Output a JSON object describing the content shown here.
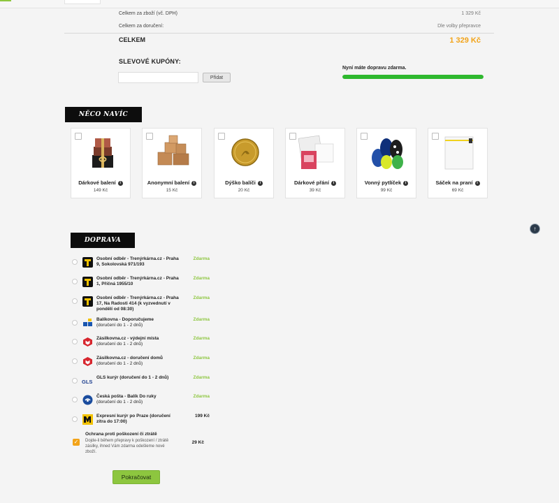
{
  "summary": {
    "items_label": "Celkem za zboží (vč. DPH)",
    "items_value": "1 329 Kč",
    "delivery_label": "Celkem za doručení:",
    "delivery_value": "Dle volby přepravce",
    "total_label": "CELKEM",
    "total_value": "1 329 Kč"
  },
  "coupons": {
    "title": "SLEVOVÉ KUPÓNY:",
    "input_value": "",
    "button_label": "Přidat"
  },
  "free_shipping": {
    "message": "Nyní máte dopravu zdarma.",
    "progress_percent": 100,
    "bar_color": "#2eb82e"
  },
  "extras": {
    "banner": "NĚCO NAVÍC",
    "items": [
      {
        "name": "Dárkové balení",
        "price": "149 Kč",
        "checked": false,
        "icon": "gift-box-icon"
      },
      {
        "name": "Anonymní balení",
        "price": "15 Kč",
        "checked": false,
        "icon": "cardboard-boxes-icon"
      },
      {
        "name": "Dýško balíči",
        "price": "20 Kč",
        "checked": false,
        "icon": "gold-coin-icon"
      },
      {
        "name": "Dárkové přání",
        "price": "39 Kč",
        "checked": false,
        "icon": "greeting-card-icon"
      },
      {
        "name": "Vonný pytlíček",
        "price": "99 Kč",
        "checked": false,
        "icon": "scent-sachet-icon"
      },
      {
        "name": "Sáček na praní",
        "price": "69 Kč",
        "checked": false,
        "icon": "laundry-bag-icon"
      }
    ]
  },
  "shipping": {
    "banner": "DOPRAVA",
    "options": [
      {
        "title": "Osobní odběr - Trenýrkárna.cz - Praha 9, Sokolovská 971/193",
        "sub": "",
        "price": "Zdarma",
        "logo": "trenyrkarna-logo-icon"
      },
      {
        "title": "Osobní odběr - Trenýrkárna.cz - Praha 1, Příčná 1955/10",
        "sub": "",
        "price": "Zdarma",
        "logo": "trenyrkarna-logo-icon"
      },
      {
        "title": "Osobní odběr - Trenýrkárna.cz - Praha 17, Na Radosti 414 (k vyzvednutí v pondělí od 08:30)",
        "sub": "",
        "price": "Zdarma",
        "logo": "trenyrkarna-logo-icon"
      },
      {
        "title": "Balíkovna - Doporučujeme",
        "sub": "(doručení do 1 - 2 dnů)",
        "price": "Zdarma",
        "logo": "balikovna-logo-icon"
      },
      {
        "title": "Zásilkovna.cz - výdejní místa",
        "sub": "(doručení do 1 - 2 dnů)",
        "price": "Zdarma",
        "logo": "zasilkovna-logo-icon"
      },
      {
        "title": "Zásilkovna.cz - doručení domů",
        "sub": "(doručení do 1 - 2 dnů)",
        "price": "Zdarma",
        "logo": "zasilkovna-logo-icon"
      },
      {
        "title": "GLS kurýr (doručení do 1 - 2 dnů)",
        "sub": "",
        "price": "Zdarma",
        "logo": "gls-logo-icon"
      },
      {
        "title": "Česká pošta - Balík Do ruky",
        "sub": "(doručení do 1 - 2 dnů)",
        "price": "Zdarma",
        "logo": "ceska-posta-logo-icon"
      },
      {
        "title": "Expresní kurýr po Praze (doručení zítra do 17:00)",
        "sub": "",
        "price": "199 Kč",
        "logo": "express-courier-logo-icon"
      }
    ],
    "insurance": {
      "title": "Ochrana proti poškození či ztrátě",
      "desc": "Dojde-li během přepravy k poškození / ztrátě zásilky, ihned Vám zdarma odešleme nové zboží.",
      "price": "29 Kč",
      "checked": true
    }
  },
  "continue_label": "Pokračovat",
  "colors": {
    "accent_green": "#8dc63f",
    "total_orange": "#f2a318",
    "banner_black": "#0d0d0d"
  }
}
